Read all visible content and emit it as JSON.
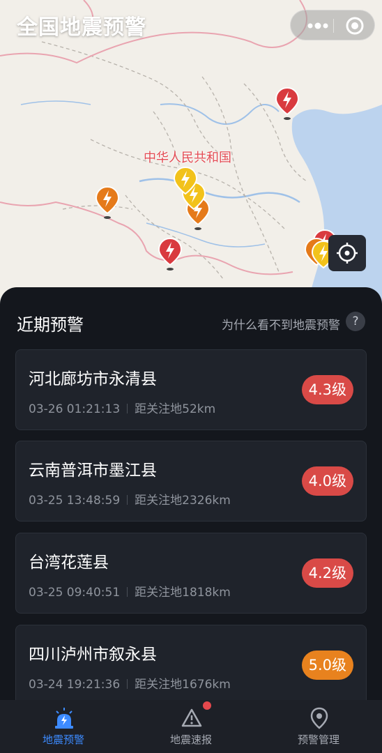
{
  "header": {
    "title": "全国地震预警"
  },
  "map": {
    "country_label": "中华人民共和国",
    "marker_colors": {
      "red": "#d93a3f",
      "orange": "#e57a1a",
      "yellow": "#f2c21b"
    }
  },
  "panel": {
    "title": "近期预警",
    "help_link": "为什么看不到地震预警",
    "help_icon_glyph": "?"
  },
  "alerts": [
    {
      "location": "河北廊坊市永清县",
      "time": "03-26 01:21:13",
      "distance": "距关注地52km",
      "magnitude": "4.3级",
      "level_color": "#d94a47"
    },
    {
      "location": "云南普洱市墨江县",
      "time": "03-25 13:48:59",
      "distance": "距关注地2326km",
      "magnitude": "4.0级",
      "level_color": "#d94a47"
    },
    {
      "location": "台湾花莲县",
      "time": "03-25 09:40:51",
      "distance": "距关注地1818km",
      "magnitude": "4.2级",
      "level_color": "#d94a47"
    },
    {
      "location": "四川泸州市叙永县",
      "time": "03-24 19:21:36",
      "distance": "距关注地1676km",
      "magnitude": "5.0级",
      "level_color": "#e8821e"
    }
  ],
  "tabs": [
    {
      "label": "地震预警",
      "icon": "alarm-icon",
      "active": true
    },
    {
      "label": "地震速报",
      "icon": "warning-icon",
      "active": false,
      "badge": true
    },
    {
      "label": "预警管理",
      "icon": "location-pin-icon",
      "active": false
    }
  ]
}
